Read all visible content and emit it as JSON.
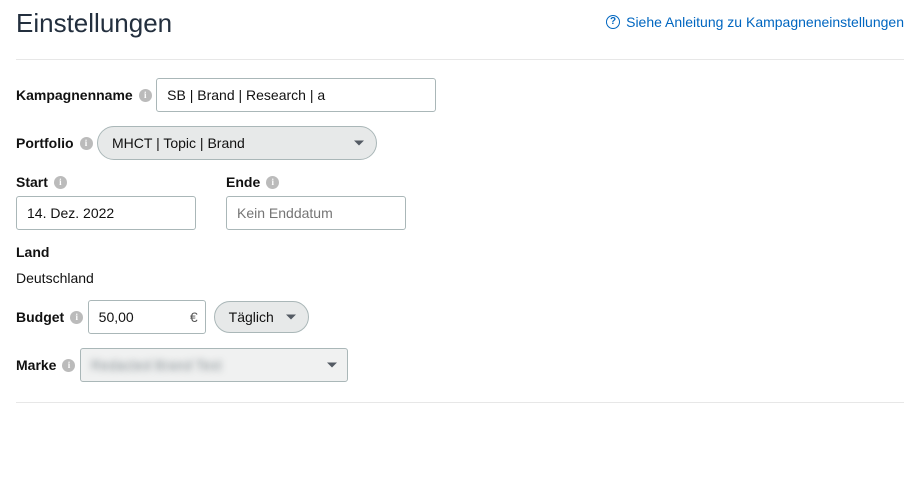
{
  "header": {
    "title": "Einstellungen",
    "help_link": "Siehe Anleitung zu Kampagneneinstellungen"
  },
  "fields": {
    "campaign_name": {
      "label": "Kampagnenname",
      "value": "SB | Brand | Research | a"
    },
    "portfolio": {
      "label": "Portfolio",
      "value": "MHCT | Topic | Brand"
    },
    "start": {
      "label": "Start",
      "value": "14. Dez. 2022"
    },
    "end": {
      "label": "Ende",
      "placeholder": "Kein Enddatum",
      "value": ""
    },
    "country": {
      "label": "Land",
      "value": "Deutschland"
    },
    "budget": {
      "label": "Budget",
      "value": "50,00",
      "currency": "€",
      "period": "Täglich"
    },
    "brand": {
      "label": "Marke",
      "value": "Redacted Brand Text"
    }
  }
}
